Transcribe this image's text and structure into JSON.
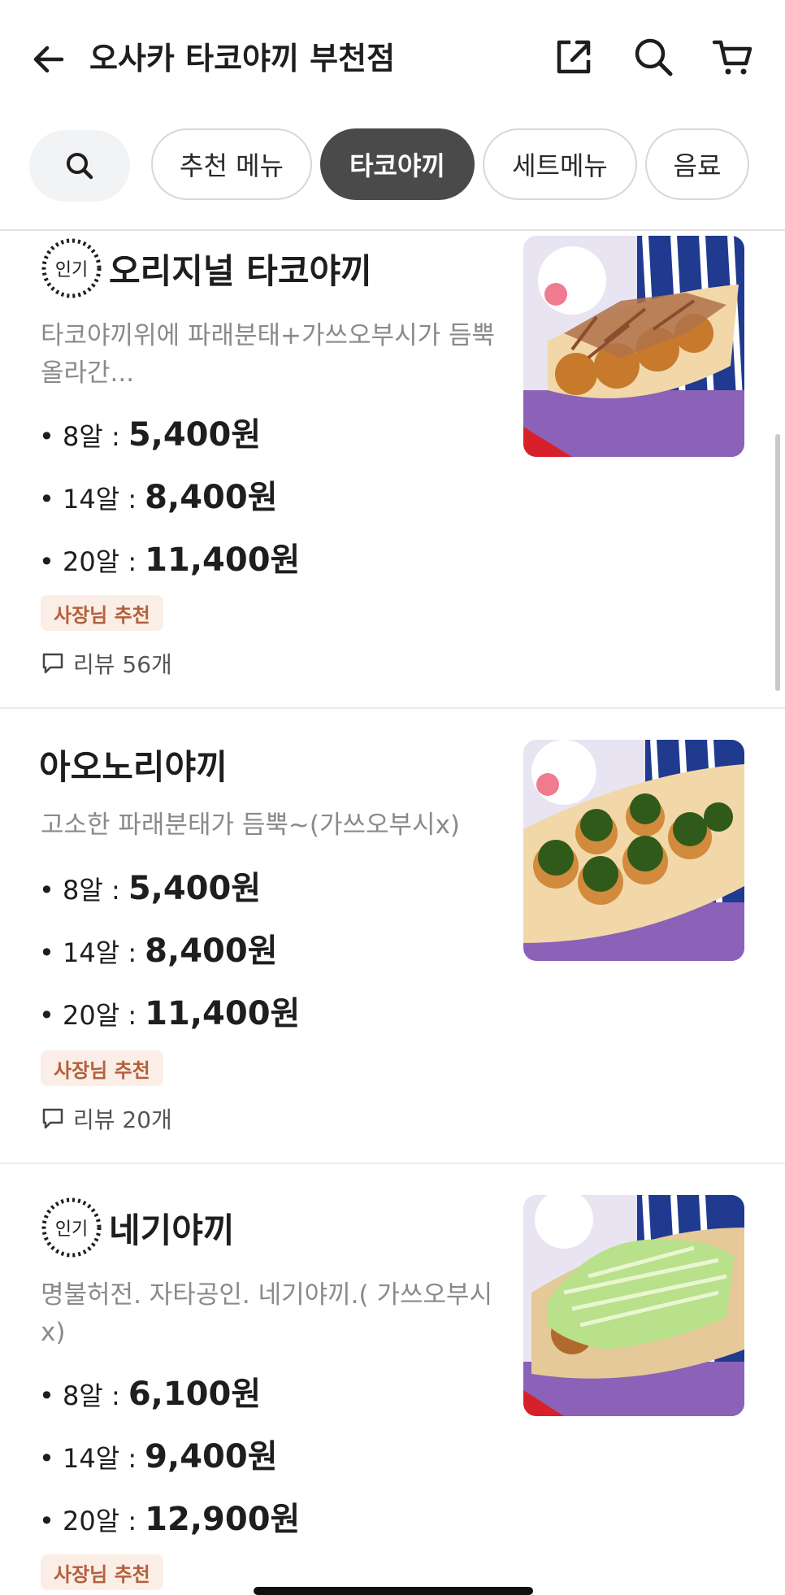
{
  "header": {
    "title": "오사카 타코야끼 부천점",
    "icons": [
      "back-arrow-icon",
      "share-icon",
      "search-icon",
      "cart-icon"
    ]
  },
  "categories": {
    "items": [
      {
        "label": "추천 메뉴",
        "active": false
      },
      {
        "label": "타코야끼",
        "active": true
      },
      {
        "label": "세트메뉴",
        "active": false
      },
      {
        "label": "음료",
        "active": false
      }
    ]
  },
  "menu": [
    {
      "popular": true,
      "badge": "인기",
      "name": "오리지널 타코야끼",
      "description": "타코야끼위에 파래분태+가쓰오부시가 듬뿍 올라간...",
      "prices": [
        {
          "label": "• 8알 :",
          "value": "5,400원"
        },
        {
          "label": "• 14알 :",
          "value": "8,400원"
        },
        {
          "label": "• 20알 :",
          "value": "11,400원"
        }
      ],
      "tag": "사장님 추천",
      "review": "리뷰 56개"
    },
    {
      "popular": false,
      "badge": "",
      "name": "아오노리야끼",
      "description": "고소한 파래분태가 듬뿍~(가쓰오부시x)",
      "prices": [
        {
          "label": "• 8알 :",
          "value": "5,400원"
        },
        {
          "label": "• 14알 :",
          "value": "8,400원"
        },
        {
          "label": "• 20알 :",
          "value": "11,400원"
        }
      ],
      "tag": "사장님 추천",
      "review": "리뷰 20개"
    },
    {
      "popular": true,
      "badge": "인기",
      "name": "네기야끼",
      "description": "명불허전. 자타공인. 네기야끼.( 가쓰오부시x)",
      "prices": [
        {
          "label": "• 8알 :",
          "value": "6,100원"
        },
        {
          "label": "• 14알 :",
          "value": "9,400원"
        },
        {
          "label": "• 20알 :",
          "value": "12,900원"
        }
      ],
      "tag": "사장님 추천"
    }
  ],
  "colors": {
    "active_pill": "#4a4a4a",
    "tag_bg": "#fbeee6",
    "tag_text": "#b4603c"
  }
}
